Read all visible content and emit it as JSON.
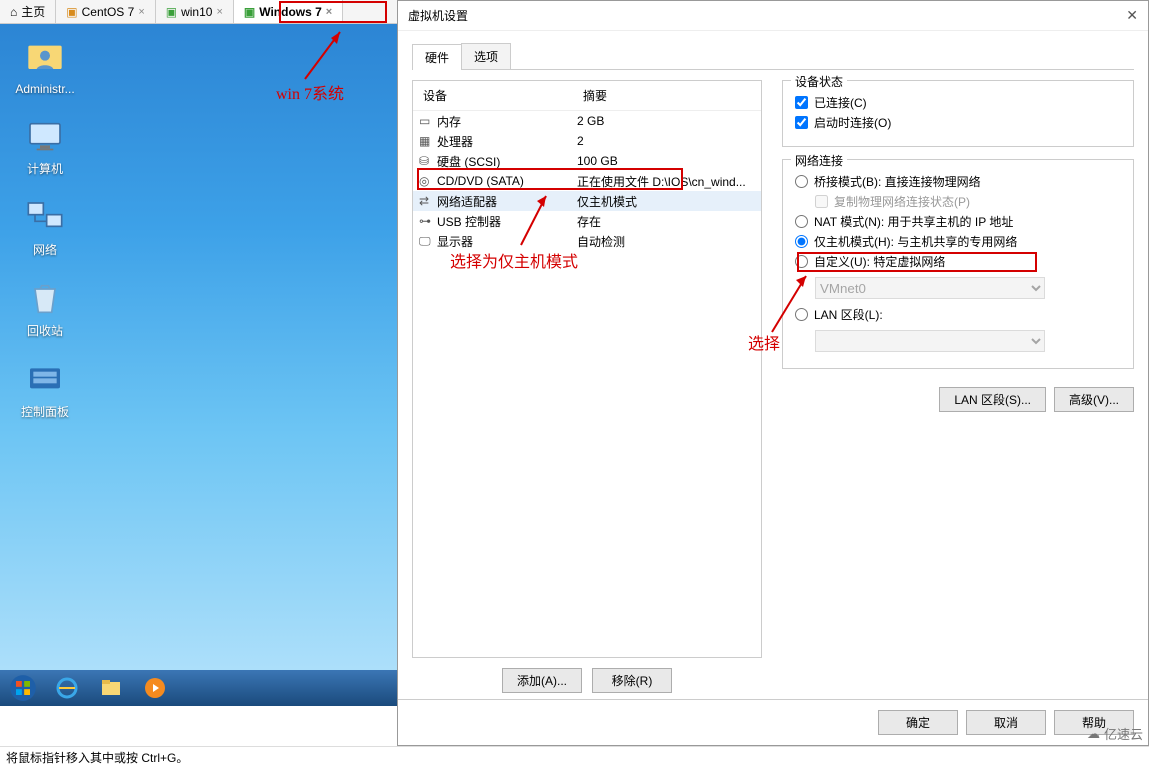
{
  "tabs": [
    "主页",
    "CentOS 7",
    "win10",
    "Windows 7"
  ],
  "active_tab": "Windows 7",
  "desktop_icons": [
    "Administr...",
    "计算机",
    "网络",
    "回收站",
    "控制面板"
  ],
  "anno": {
    "win7": "win 7系统",
    "hostonly": "选择为仅主机模式",
    "select": "选择"
  },
  "dialog": {
    "title": "虚拟机设置",
    "tabs": [
      "硬件",
      "选项"
    ],
    "hw_header": {
      "dev": "设备",
      "sum": "摘要"
    },
    "hw": [
      {
        "icon": "mem",
        "name": "内存",
        "sum": "2 GB"
      },
      {
        "icon": "cpu",
        "name": "处理器",
        "sum": "2"
      },
      {
        "icon": "disk",
        "name": "硬盘 (SCSI)",
        "sum": "100 GB"
      },
      {
        "icon": "cd",
        "name": "CD/DVD (SATA)",
        "sum": "正在使用文件 D:\\IOS\\cn_wind..."
      },
      {
        "icon": "net",
        "name": "网络适配器",
        "sum": "仅主机模式"
      },
      {
        "icon": "usb",
        "name": "USB 控制器",
        "sum": "存在"
      },
      {
        "icon": "disp",
        "name": "显示器",
        "sum": "自动检测"
      }
    ],
    "add": "添加(A)...",
    "remove": "移除(R)",
    "devstate": {
      "grp": "设备状态",
      "connected": "已连接(C)",
      "connect_on": "启动时连接(O)"
    },
    "net": {
      "grp": "网络连接",
      "bridge": "桥接模式(B): 直接连接物理网络",
      "repl": "复制物理网络连接状态(P)",
      "nat": "NAT 模式(N): 用于共享主机的 IP 地址",
      "host": "仅主机模式(H): 与主机共享的专用网络",
      "custom": "自定义(U): 特定虚拟网络",
      "vmnet": "VMnet0",
      "lan": "LAN 区段(L):"
    },
    "lanbtn": "LAN 区段(S)...",
    "advbtn": "高级(V)...",
    "ok": "确定",
    "cancel": "取消",
    "help": "帮助"
  },
  "status": "将鼠标指针移入其中或按 Ctrl+G。",
  "watermark": "亿速云"
}
